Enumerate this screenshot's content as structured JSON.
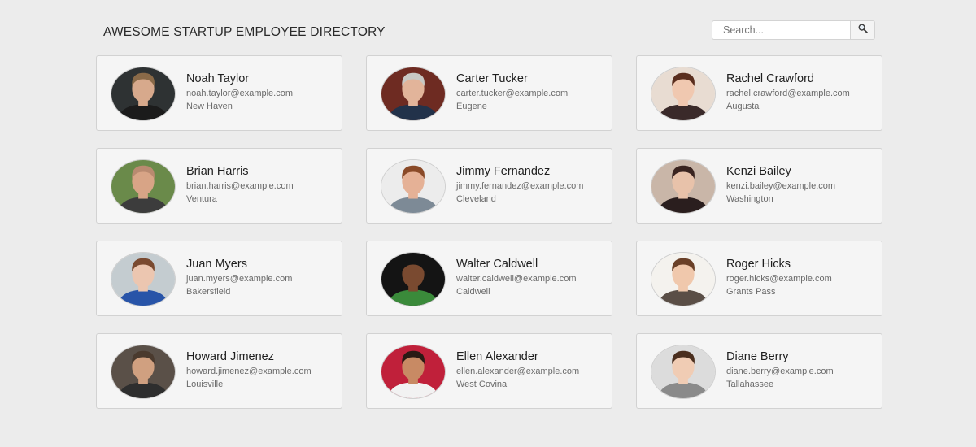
{
  "header": {
    "title": "AWESOME STARTUP EMPLOYEE DIRECTORY",
    "search_placeholder": "Search...",
    "search_icon": "magnifier-icon"
  },
  "employees": [
    {
      "name": "Noah Taylor",
      "email": "noah.taylor@example.com",
      "city": "New Haven",
      "photo": {
        "bg": "#2e3233",
        "skin": "#d7a98c",
        "hair": "#8a6a48",
        "shirt": "#1b1b1b"
      }
    },
    {
      "name": "Carter Tucker",
      "email": "carter.tucker@example.com",
      "city": "Eugene",
      "photo": {
        "bg": "#6e2b22",
        "skin": "#e2b49a",
        "hair": "#c8c8c4",
        "shirt": "#22324a"
      }
    },
    {
      "name": "Rachel Crawford",
      "email": "rachel.crawford@example.com",
      "city": "Augusta",
      "photo": {
        "bg": "#e8dcd2",
        "skin": "#f0c8b0",
        "hair": "#5a2e1e",
        "shirt": "#3a2a2a"
      }
    },
    {
      "name": "Brian Harris",
      "email": "brian.harris@example.com",
      "city": "Ventura",
      "photo": {
        "bg": "#6a8a4a",
        "skin": "#d8a486",
        "hair": "#b98a70",
        "shirt": "#3c3c3c"
      }
    },
    {
      "name": "Jimmy Fernandez",
      "email": "jimmy.fernandez@example.com",
      "city": "Cleveland",
      "photo": {
        "bg": "#ececec",
        "skin": "#e5b196",
        "hair": "#8a4a28",
        "shirt": "#7d8a96"
      }
    },
    {
      "name": "Kenzi Bailey",
      "email": "kenzi.bailey@example.com",
      "city": "Washington",
      "photo": {
        "bg": "#c9b6a8",
        "skin": "#e8c2aa",
        "hair": "#3a2420",
        "shirt": "#2a1e1e"
      }
    },
    {
      "name": "Juan Myers",
      "email": "juan.myers@example.com",
      "city": "Bakersfield",
      "photo": {
        "bg": "#c4ccd0",
        "skin": "#ecc6b0",
        "hair": "#7a4a30",
        "shirt": "#2854a8"
      }
    },
    {
      "name": "Walter Caldwell",
      "email": "walter.caldwell@example.com",
      "city": "Caldwell",
      "photo": {
        "bg": "#141414",
        "skin": "#7a4a30",
        "hair": "#141414",
        "shirt": "#3a8a3a"
      }
    },
    {
      "name": "Roger Hicks",
      "email": "roger.hicks@example.com",
      "city": "Grants Pass",
      "photo": {
        "bg": "#f4f2ee",
        "skin": "#f0c8ac",
        "hair": "#6a4028",
        "shirt": "#5a4e46"
      }
    },
    {
      "name": "Howard Jimenez",
      "email": "howard.jimenez@example.com",
      "city": "Louisville",
      "photo": {
        "bg": "#5a5048",
        "skin": "#d0a080",
        "hair": "#4a3a2e",
        "shirt": "#2e2e2e"
      }
    },
    {
      "name": "Ellen Alexander",
      "email": "ellen.alexander@example.com",
      "city": "West Covina",
      "photo": {
        "bg": "#c0203a",
        "skin": "#c88a64",
        "hair": "#2a1a14",
        "shirt": "#f2f2f2"
      }
    },
    {
      "name": "Diane Berry",
      "email": "diane.berry@example.com",
      "city": "Tallahassee",
      "photo": {
        "bg": "#dcdcdc",
        "skin": "#f0ccb4",
        "hair": "#4a2e1e",
        "shirt": "#8a8a8a"
      }
    }
  ]
}
